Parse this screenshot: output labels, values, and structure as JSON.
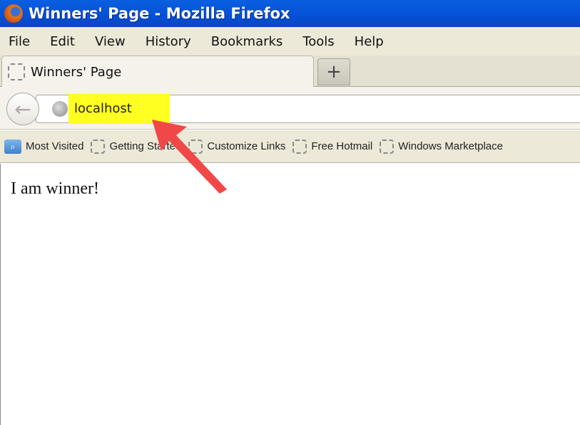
{
  "window": {
    "title": "Winners' Page - Mozilla Firefox",
    "icon": "firefox-icon"
  },
  "menu": [
    "File",
    "Edit",
    "View",
    "History",
    "Bookmarks",
    "Tools",
    "Help"
  ],
  "tabs": [
    {
      "label": "Winners' Page"
    }
  ],
  "new_tab_label": "+",
  "navbar": {
    "back_icon": "←",
    "url": "localhost",
    "highlight_color": "#ffff22"
  },
  "bookmarks": [
    {
      "label": "Most Visited",
      "icon": "folder-search-icon"
    },
    {
      "label": "Getting Started"
    },
    {
      "label": "Customize Links"
    },
    {
      "label": "Free Hotmail"
    },
    {
      "label": "Windows Marketplace"
    }
  ],
  "content": {
    "text": "I am winner!"
  },
  "annotation": {
    "arrow_color": "#f04848"
  }
}
